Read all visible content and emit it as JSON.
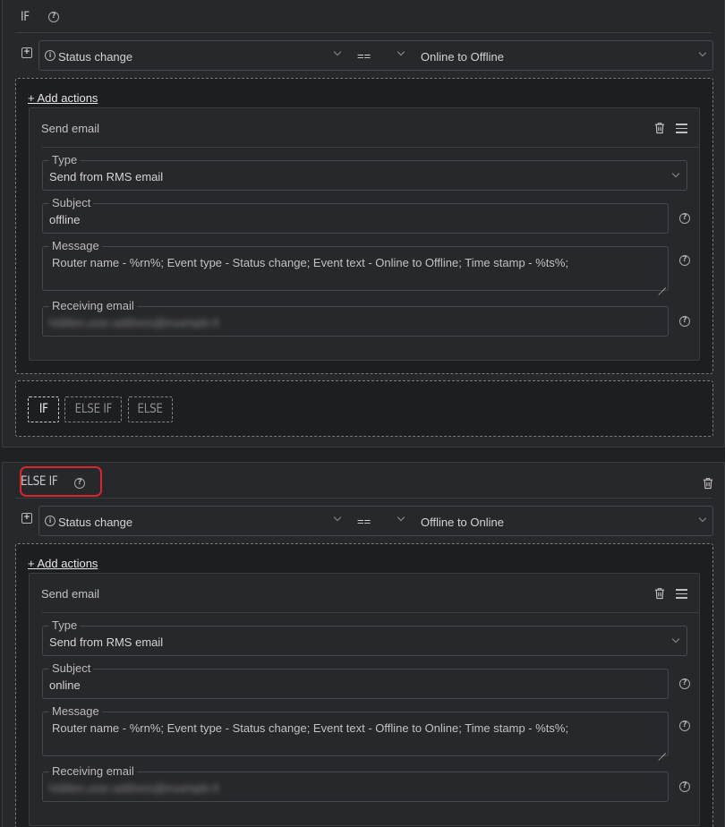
{
  "if_block": {
    "title": "IF",
    "condition": {
      "field": "Status change",
      "operator": "==",
      "value": "Online to Offline"
    },
    "add_actions_label": "+ Add actions",
    "action": {
      "title": "Send email",
      "type_label": "Type",
      "type_value": "Send from RMS email",
      "subject_label": "Subject",
      "subject_value": "offline",
      "message_label": "Message",
      "message_value": "Router name - %rn%; Event type - Status change; Event text - Online to Offline; Time stamp - %ts%;",
      "receiving_label": "Receiving email",
      "receiving_value": "hidden.user.address@example.lt"
    },
    "branch_buttons": [
      "IF",
      "ELSE IF",
      "ELSE"
    ]
  },
  "else_if_block": {
    "title": "ELSE IF",
    "condition": {
      "field": "Status change",
      "operator": "==",
      "value": "Offline to Online"
    },
    "add_actions_label": "+ Add actions",
    "action": {
      "title": "Send email",
      "type_label": "Type",
      "type_value": "Send from RMS email",
      "subject_label": "Subject",
      "subject_value": "online",
      "message_label": "Message",
      "message_value": "Router name - %rn%; Event type - Status change; Event text - Offline to Online; Time stamp - %ts%;",
      "receiving_label": "Receiving email",
      "receiving_value": "hidden.user.address@example.lt"
    }
  },
  "icons": {
    "help": "?",
    "info": "i",
    "expand": "+"
  },
  "colors": {
    "highlight": "#d8262b",
    "background": "#202124",
    "panel": "#27282b"
  }
}
